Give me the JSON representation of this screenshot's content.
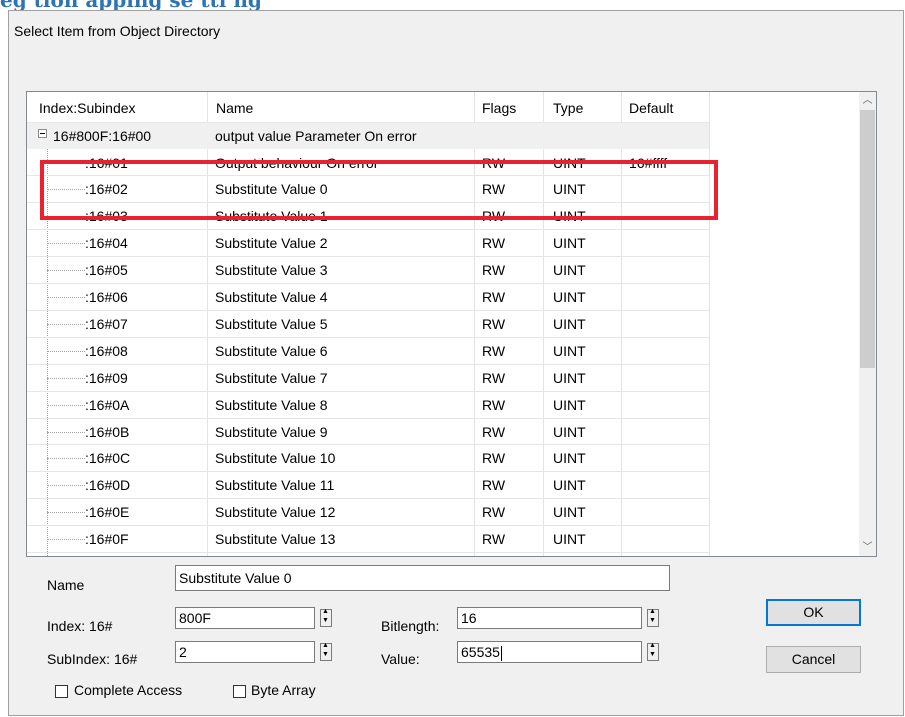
{
  "heading_fragment": "eg tion apping se tti ng",
  "dialog": {
    "title": "Select Item from Object Directory"
  },
  "columns": [
    "Index:Subindex",
    "Name",
    "Flags",
    "Type",
    "Default"
  ],
  "parent": {
    "index": "16#800F:16#00",
    "name": "output value Parameter On error",
    "flags": "",
    "type": "",
    "default": ""
  },
  "rows": [
    {
      "index": ":16#01",
      "name": "Output behaviour On error",
      "flags": "RW",
      "type": "UINT",
      "default": "16#ffff"
    },
    {
      "index": ":16#02",
      "name": "Substitute Value 0",
      "flags": "RW",
      "type": "UINT",
      "default": ""
    },
    {
      "index": ":16#03",
      "name": "Substitute Value 1",
      "flags": "RW",
      "type": "UINT",
      "default": ""
    },
    {
      "index": ":16#04",
      "name": "Substitute Value 2",
      "flags": "RW",
      "type": "UINT",
      "default": ""
    },
    {
      "index": ":16#05",
      "name": "Substitute Value 3",
      "flags": "RW",
      "type": "UINT",
      "default": ""
    },
    {
      "index": ":16#06",
      "name": "Substitute Value 4",
      "flags": "RW",
      "type": "UINT",
      "default": ""
    },
    {
      "index": ":16#07",
      "name": "Substitute Value 5",
      "flags": "RW",
      "type": "UINT",
      "default": ""
    },
    {
      "index": ":16#08",
      "name": "Substitute Value 6",
      "flags": "RW",
      "type": "UINT",
      "default": ""
    },
    {
      "index": ":16#09",
      "name": "Substitute Value 7",
      "flags": "RW",
      "type": "UINT",
      "default": ""
    },
    {
      "index": ":16#0A",
      "name": "Substitute Value 8",
      "flags": "RW",
      "type": "UINT",
      "default": ""
    },
    {
      "index": ":16#0B",
      "name": "Substitute Value 9",
      "flags": "RW",
      "type": "UINT",
      "default": ""
    },
    {
      "index": ":16#0C",
      "name": "Substitute Value 10",
      "flags": "RW",
      "type": "UINT",
      "default": ""
    },
    {
      "index": ":16#0D",
      "name": "Substitute Value 11",
      "flags": "RW",
      "type": "UINT",
      "default": ""
    },
    {
      "index": ":16#0E",
      "name": "Substitute Value 12",
      "flags": "RW",
      "type": "UINT",
      "default": ""
    },
    {
      "index": ":16#0F",
      "name": "Substitute Value 13",
      "flags": "RW",
      "type": "UINT",
      "default": ""
    }
  ],
  "form": {
    "name_label": "Name",
    "name_value": "Substitute Value 0",
    "index_label": "Index: 16#",
    "index_value": "800F",
    "subindex_label": "SubIndex: 16#",
    "subindex_value": "2",
    "bitlength_label": "Bitlength:",
    "bitlength_value": "16",
    "value_label": "Value:",
    "value_value": "65535",
    "complete_access_label": "Complete Access",
    "complete_access_checked": false,
    "byte_array_label": "Byte Array",
    "byte_array_checked": false
  },
  "buttons": {
    "ok": "OK",
    "cancel": "Cancel"
  },
  "colors": {
    "highlight": "#e8222e",
    "default_button_border": "#0078d7",
    "heading": "#2e74b5"
  },
  "icons": {
    "expander": "minus-box-icon",
    "scroll_up": "chevron-up-icon",
    "scroll_down": "chevron-down-icon"
  }
}
